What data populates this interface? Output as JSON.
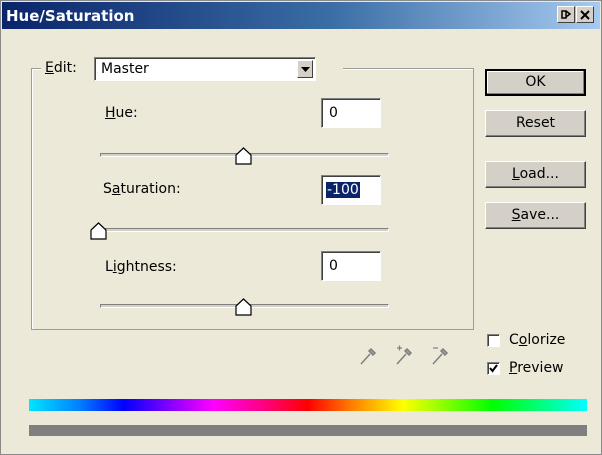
{
  "window": {
    "title": "Hue/Saturation"
  },
  "edit": {
    "label": "Edit:",
    "selected": "Master"
  },
  "hue": {
    "label": "Hue:",
    "value": "0",
    "slider_position": 0.5
  },
  "saturation": {
    "label": "Saturation:",
    "value": "-100",
    "slider_position": 0.0
  },
  "lightness": {
    "label": "Lightness:",
    "value": "0",
    "slider_position": 0.5
  },
  "buttons": {
    "ok": "OK",
    "reset": "Reset",
    "load": "Load...",
    "save": "Save..."
  },
  "options": {
    "colorize": {
      "label": "Colorize",
      "checked": false
    },
    "preview": {
      "label": "Preview",
      "checked": true
    }
  },
  "icons": {
    "eyedroppers": [
      "eyedropper-icon",
      "eyedropper-plus-icon",
      "eyedropper-minus-icon"
    ]
  },
  "colors": {
    "dialog_bg": "#ece9d8",
    "title_start": "#0a246a",
    "title_end": "#a6caf0",
    "selection": "#0a246a"
  }
}
